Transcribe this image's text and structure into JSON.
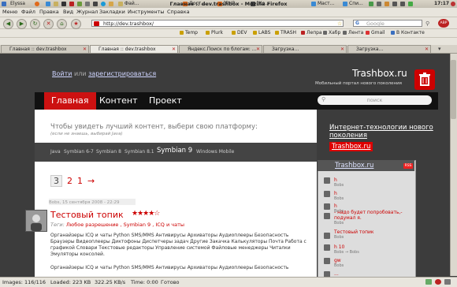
{
  "system_panel": {
    "user": "Elyssa",
    "tasks": [
      "Фай...",
      "Дост...",
      "[PHP...",
      "[Ко...",
      "Маст...",
      "Спи..."
    ],
    "window_title": "Главная :: dev.trashbox - Mozilla Firefox",
    "clock": "17:17"
  },
  "menu": [
    "Меню",
    "Файл",
    "Правка",
    "Вид",
    "Журнал",
    "Закладки",
    "Инструменты",
    "Справка"
  ],
  "navbar": {
    "url": "http://dev.trashbox/",
    "search_placeholder": "Google"
  },
  "bookmarks": [
    "Temp",
    "Plurk",
    "DEV",
    "LABS",
    "TRASH",
    "Лепра",
    "Хабр",
    "Лента",
    "Gmail",
    "В Контакте"
  ],
  "tabs": [
    {
      "title": "Главная :: dev.trashbox",
      "active": false
    },
    {
      "title": "Главная :: dev.trashbox",
      "active": true
    },
    {
      "title": "Яндекс.Поиск по блогам: ...",
      "active": false
    },
    {
      "title": "Загрузка...",
      "active": false
    },
    {
      "title": "Загрузка...",
      "active": false
    }
  ],
  "site": {
    "login": "Войти",
    "or": "или",
    "register": "зарегистрироваться",
    "logo": "Trashbox.ru",
    "tagline": "Мобильный портал нового поколения",
    "nav": [
      "Главная",
      "Контент",
      "Проект"
    ],
    "search_placeholder": "поиск",
    "promo": "Чтобы увидеть лучший контент, выбери свою платформу:",
    "promo_hint": "(если не знаешь, выбирай Java)",
    "platforms": [
      "Java",
      "Symbian 6-7",
      "Symbian 8",
      "Symbian 8.1",
      "Symbian 9",
      "Windows Mobile"
    ],
    "pages": [
      "3",
      "2",
      "1",
      "→"
    ],
    "post_meta": "Bobs, 15 сентября 2008 - 22:29",
    "post_title": "Тестовый топик",
    "stars": "★★★★☆",
    "tags_label": "Теги:",
    "tags": "Любое разрешение , Symbian 9 , ICQ и чаты",
    "body1": "Органайзеры ICQ и чаты Python SMS/MMS Антивирусы Архиваторы Аудиоплееры Безопасность Браузеры Видеоплееры Диктофоны Диспетчеры задач Другие Закачка Калькуляторы Почта Работа с графикой Словари Текстовые редакторы Управление системой Файловые менеджеры Читалки Эмуляторы консолей.",
    "body2": "Органайзеры ICQ и чаты Python SMS/MMS Антивирусы Архиваторы Аудиоплееры Безопасность"
  },
  "sidebar": {
    "link1": "Интернет-технологии нового поколения",
    "link2": "Trashbox.ru",
    "box_title": "Trashbox.ru",
    "rss": "RSS",
    "items": [
      {
        "title": "h",
        "author": "Bobs"
      },
      {
        "title": "h",
        "author": "Bobs"
      },
      {
        "title": "h",
        "author": "Bobs"
      },
      {
        "title": "- надо будет попробовать,- подумал я.",
        "author": "Bobs"
      },
      {
        "title": "Тестовый топик",
        "author": "Bobs"
      },
      {
        "title": "h 10",
        "author": "Bobs → Bobs"
      },
      {
        "title": "gw",
        "author": "Bobs"
      },
      {
        "title": "...",
        "author": ""
      }
    ]
  },
  "status": {
    "images": "Images: 116/116",
    "loaded": "Loaded: 223 KB",
    "speed": "322.25 KB/s",
    "time": "Time: 0:00",
    "done": "Готово"
  }
}
